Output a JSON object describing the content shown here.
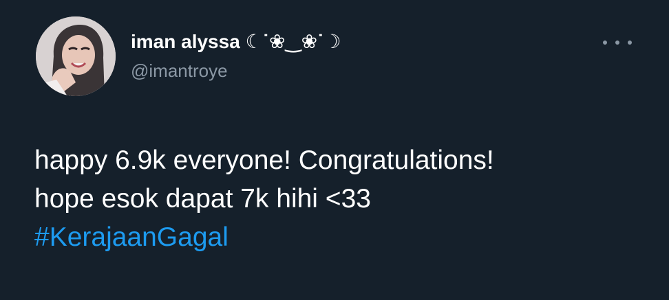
{
  "user": {
    "display_name": "iman alyssa ☾˙❀‿❀˙☽",
    "handle": "@imantroye"
  },
  "icons": {
    "avatar": "profile-photo",
    "more": "more-horizontal-icon"
  },
  "tweet": {
    "line1": "happy 6.9k everyone! Congratulations!",
    "line2": "hope esok dapat 7k hihi <33",
    "hashtag": "#KerajaanGagal"
  },
  "colors": {
    "background": "#15202b",
    "text": "#ffffff",
    "secondary_text": "#8b98a5",
    "link": "#1d9bf0"
  }
}
